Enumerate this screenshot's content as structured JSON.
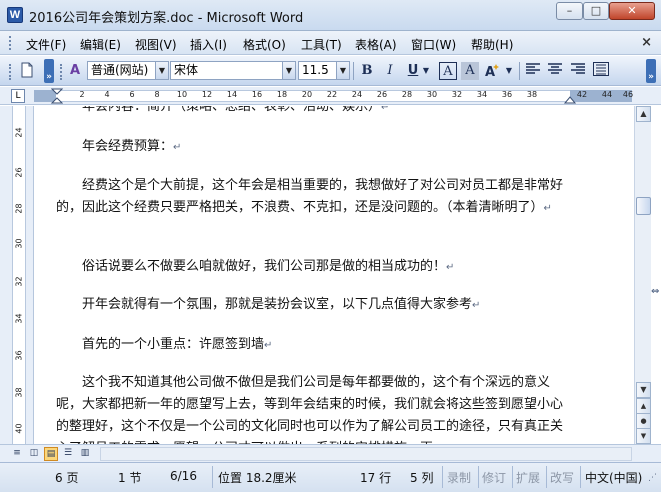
{
  "window": {
    "title": "2016公司年会策划方案.doc - Microsoft Word",
    "app_icon_letter": "W",
    "minimize_symbol": "–",
    "maximize_symbol": "□",
    "close_symbol": "✕"
  },
  "menu": {
    "items": [
      "文件(F)",
      "编辑(E)",
      "视图(V)",
      "插入(I)",
      "格式(O)",
      "工具(T)",
      "表格(A)",
      "窗口(W)",
      "帮助(H)"
    ],
    "close_document_symbol": "×"
  },
  "toolbar": {
    "style_value": "普通(网站)",
    "font_value": "宋体",
    "size_value": "11.5",
    "bold": "B",
    "italic": "I",
    "underline": "U",
    "char_border": "A",
    "char_shading": "A",
    "more_symbol": "»",
    "icons": [
      "new-document-icon",
      "styles-pane-icon",
      "bold-icon",
      "italic-icon",
      "underline-icon",
      "character-border-icon",
      "character-shading-icon",
      "text-effect-icon",
      "align-left-icon",
      "align-center-icon",
      "align-right-icon",
      "justify-icon"
    ]
  },
  "ruler": {
    "corner_symbol": "L",
    "horizontal_ticks": [
      "2",
      "4",
      "6",
      "8",
      "10",
      "12",
      "14",
      "16",
      "18",
      "20",
      "22",
      "24",
      "26",
      "28",
      "30",
      "32",
      "34",
      "36",
      "38",
      "42",
      "44",
      "46"
    ],
    "vertical_ticks": [
      "24",
      "26",
      "28",
      "30",
      "32",
      "34",
      "36",
      "38",
      "40"
    ]
  },
  "document": {
    "paragraphs": [
      "年会内容：简介（策略、总结、表彰、活动、娱乐）",
      "年会经费预算：",
      "经费这个是个大前提，这个年会是相当重要的，我想做好了对公司对员工都是非常好的，因此这个经费只要严格把关，不浪费、不克扣，还是没问题的。（本着清晰明了）",
      "俗话说要么不做要么咱就做好，我们公司那是做的相当成功的！",
      "开年会就得有一个氛围，那就是装扮会议室，以下几点值得大家参考",
      "首先的一个小重点：许愿签到墙",
      "这个我不知道其他公司做不做但是我们公司是每年都要做的，这个有个深远的意义呢，大家都把新一年的愿望写上去，等到年会结束的时候，我们就会将这些签到愿望小心的整理好，这个不仅是一个公司的文化同时也可以作为了解公司员工的途径，只有真正关心了解员工的需求、愿望，公司才可以做出一系列的安排措施，再"
    ],
    "paragraph_marks": [
      "↵",
      "↵",
      "↵",
      "↵",
      "↵",
      "↵",
      ""
    ]
  },
  "scrollbar": {
    "up_symbol": "▲",
    "down_symbol": "▼",
    "prev_page_symbol": "▲",
    "select_browse_symbol": "●",
    "next_page_symbol": "▼",
    "thumb_position_fraction": 0.31
  },
  "view_buttons": [
    "normal-view",
    "web-layout-view",
    "print-layout-view",
    "outline-view",
    "reading-view"
  ],
  "status": {
    "page": "6 页",
    "section": "1 节",
    "page_of": "6/16",
    "position": "位置 18.2厘米",
    "line": "17 行",
    "column": "5 列",
    "rec": "录制",
    "trk": "修订",
    "ext": "扩展",
    "ovr": "改写",
    "language": "中文(中国)"
  }
}
